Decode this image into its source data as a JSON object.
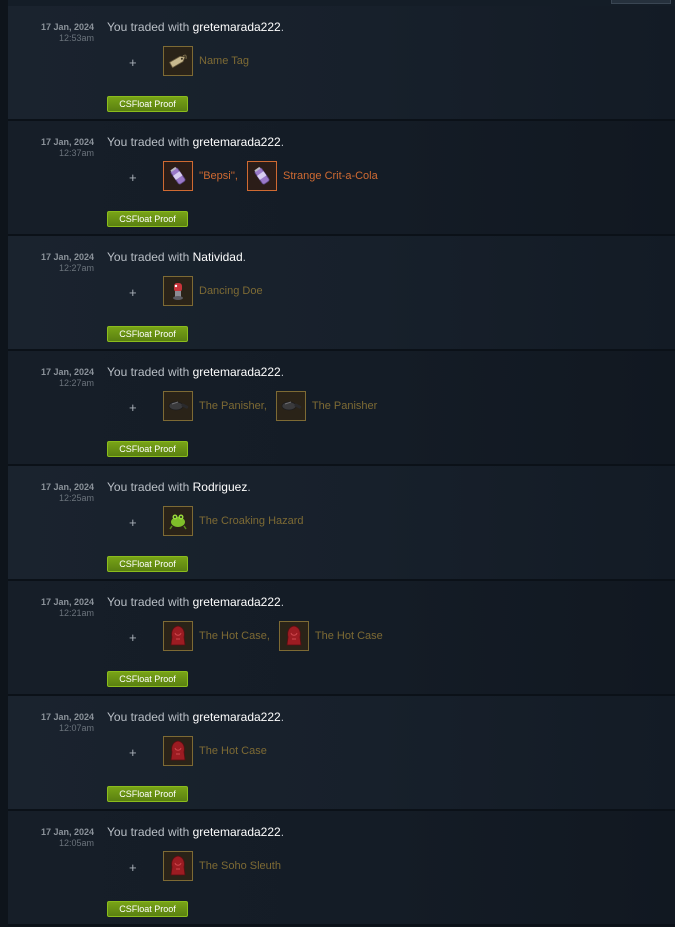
{
  "colors": {
    "unique_item": "#7d6a34",
    "strange_item": "#cf6a32",
    "proof_button": "#6a9a18",
    "username": "#ffffff"
  },
  "trades": [
    {
      "date": "17 Jan, 2024",
      "time": "12:53am",
      "prefix": "You traded with ",
      "user": "gretemarada222",
      "suffix": ".",
      "plus": "+",
      "proof": "CSFloat Proof",
      "items": [
        {
          "name": "Name Tag",
          "icon": "name-tag-icon",
          "quality": "unique"
        }
      ]
    },
    {
      "date": "17 Jan, 2024",
      "time": "12:37am",
      "prefix": "You traded with ",
      "user": "gretemarada222",
      "suffix": ".",
      "plus": "+",
      "proof": "CSFloat Proof",
      "items": [
        {
          "name": "''Bepsi'',",
          "icon": "soda-can-icon",
          "quality": "strange"
        },
        {
          "name": "Strange Crit-a-Cola",
          "icon": "soda-can-icon",
          "quality": "strange"
        }
      ]
    },
    {
      "date": "17 Jan, 2024",
      "time": "12:27am",
      "prefix": "You traded with ",
      "user": "Natividad",
      "suffix": ".",
      "plus": "+",
      "proof": "CSFloat Proof",
      "items": [
        {
          "name": "Dancing Doe",
          "icon": "doe-hat-icon",
          "quality": "unique"
        }
      ]
    },
    {
      "date": "17 Jan, 2024",
      "time": "12:27am",
      "prefix": "You traded with ",
      "user": "gretemarada222",
      "suffix": ".",
      "plus": "+",
      "proof": "CSFloat Proof",
      "items": [
        {
          "name": "The Panisher,",
          "icon": "frying-pan-icon",
          "quality": "unique"
        },
        {
          "name": "The Panisher",
          "icon": "frying-pan-icon",
          "quality": "unique"
        }
      ]
    },
    {
      "date": "17 Jan, 2024",
      "time": "12:25am",
      "prefix": "You traded with ",
      "user": "Rodriguez",
      "suffix": ".",
      "plus": "+",
      "proof": "CSFloat Proof",
      "items": [
        {
          "name": "The Croaking Hazard",
          "icon": "frog-icon",
          "quality": "unique"
        }
      ]
    },
    {
      "date": "17 Jan, 2024",
      "time": "12:21am",
      "prefix": "You traded with ",
      "user": "gretemarada222",
      "suffix": ".",
      "plus": "+",
      "proof": "CSFloat Proof",
      "items": [
        {
          "name": "The Hot Case,",
          "icon": "red-hood-icon",
          "quality": "unique"
        },
        {
          "name": "The Hot Case",
          "icon": "red-hood-icon",
          "quality": "unique"
        }
      ]
    },
    {
      "date": "17 Jan, 2024",
      "time": "12:07am",
      "prefix": "You traded with ",
      "user": "gretemarada222",
      "suffix": ".",
      "plus": "+",
      "proof": "CSFloat Proof",
      "items": [
        {
          "name": "The Hot Case",
          "icon": "red-hood-icon",
          "quality": "unique"
        }
      ]
    },
    {
      "date": "17 Jan, 2024",
      "time": "12:05am",
      "prefix": "You traded with ",
      "user": "gretemarada222",
      "suffix": ".",
      "plus": "+",
      "proof": "CSFloat Proof",
      "items": [
        {
          "name": "The Soho Sleuth",
          "icon": "red-hood-icon",
          "quality": "unique"
        }
      ]
    }
  ]
}
